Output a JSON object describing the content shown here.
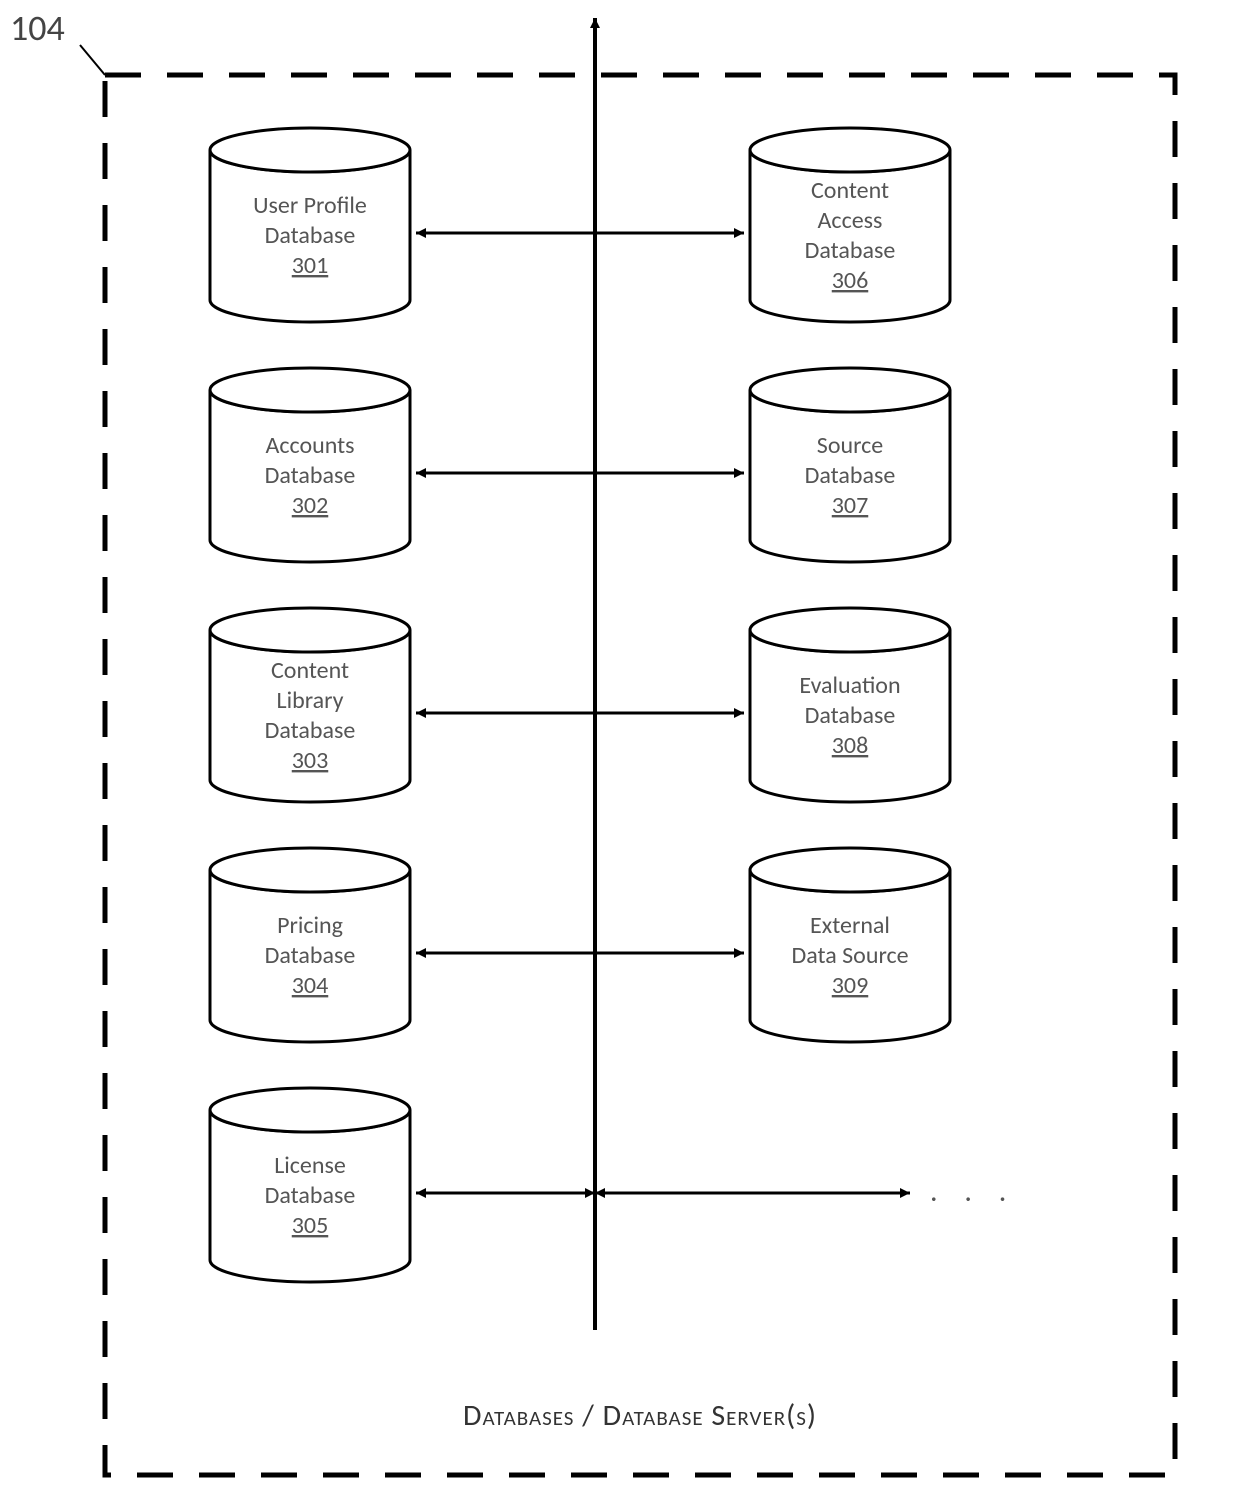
{
  "refNumber": "104",
  "caption": "Databases / Database Server(s)",
  "ellipsis": ". . .",
  "left": [
    {
      "lines": [
        "User Profile",
        "Database"
      ],
      "ref": "301"
    },
    {
      "lines": [
        "Accounts",
        "Database"
      ],
      "ref": "302"
    },
    {
      "lines": [
        "Content",
        "Library",
        "Database"
      ],
      "ref": "303"
    },
    {
      "lines": [
        "Pricing",
        "Database"
      ],
      "ref": "304"
    },
    {
      "lines": [
        "License",
        "Database"
      ],
      "ref": "305"
    }
  ],
  "right": [
    {
      "lines": [
        "Content",
        "Access",
        "Database"
      ],
      "ref": "306"
    },
    {
      "lines": [
        "Source",
        "Database"
      ],
      "ref": "307"
    },
    {
      "lines": [
        "Evaluation",
        "Database"
      ],
      "ref": "308"
    },
    {
      "lines": [
        "External",
        "Data Source"
      ],
      "ref": "309"
    }
  ]
}
